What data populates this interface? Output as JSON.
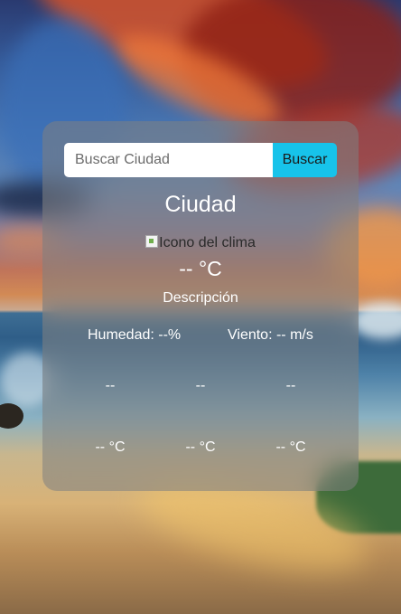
{
  "search": {
    "placeholder": "Buscar Ciudad",
    "button_label": "Buscar"
  },
  "weather": {
    "city": "Ciudad",
    "icon_alt": "Icono del clima",
    "temperature": "-- °C",
    "description": "Descripción",
    "humidity": "Humedad: --%",
    "wind": "Viento: -- m/s"
  },
  "forecast": [
    {
      "day": "--",
      "temp": "-- °C"
    },
    {
      "day": "--",
      "temp": "-- °C"
    },
    {
      "day": "--",
      "temp": "-- °C"
    }
  ],
  "colors": {
    "button": "#17c3ea",
    "card": "rgba(128,128,128,0.55)"
  }
}
